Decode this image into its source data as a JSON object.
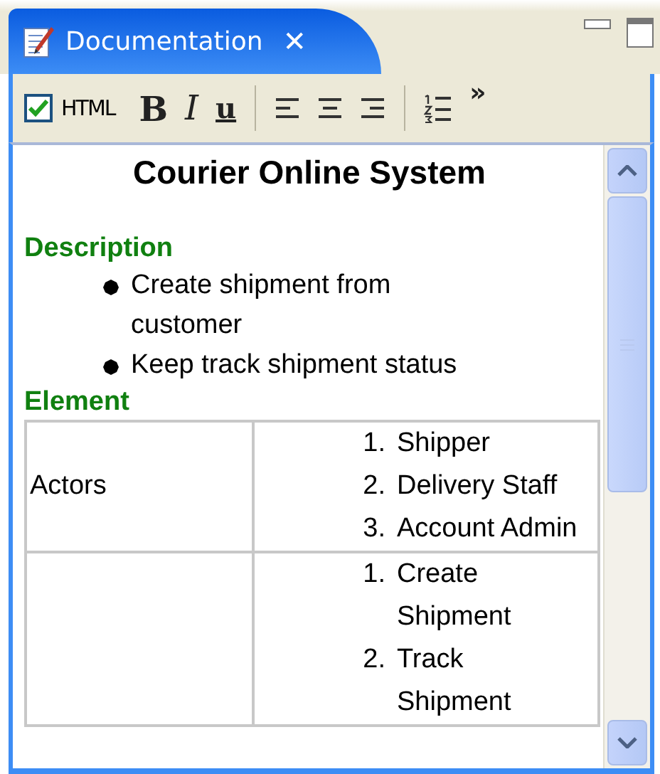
{
  "tab": {
    "title": "Documentation",
    "close": "✕"
  },
  "toolbar": {
    "html_mode": {
      "label": "HTML",
      "checked": true
    },
    "buttons": [
      {
        "kind": "bold",
        "label": "B"
      },
      {
        "kind": "italic",
        "label": "I"
      },
      {
        "kind": "underline",
        "label": "u"
      },
      {
        "kind": "sep"
      },
      {
        "kind": "align-left"
      },
      {
        "kind": "align-center"
      },
      {
        "kind": "align-right"
      },
      {
        "kind": "sep"
      },
      {
        "kind": "numbered-list"
      }
    ],
    "overflow": "»"
  },
  "document": {
    "title": "Courier Online System",
    "sections": [
      {
        "heading": "Description",
        "kind": "bullets",
        "items": [
          "Create shipment from customer",
          "Keep track shipment status"
        ]
      },
      {
        "heading": "Element",
        "kind": "table",
        "rows": [
          {
            "column_1": "Actors",
            "column_2": [
              {
                "number": "1.",
                "text": "Shipper"
              },
              {
                "number": "2.",
                "text": "Delivery Staff"
              },
              {
                "number": "3.",
                "text": "Account Admin"
              }
            ]
          },
          {
            "column_2": [
              {
                "number": "1.",
                "text": "Create Shipment"
              },
              {
                "number": "2.",
                "text": "Track Shipment"
              }
            ]
          }
        ]
      }
    ]
  }
}
